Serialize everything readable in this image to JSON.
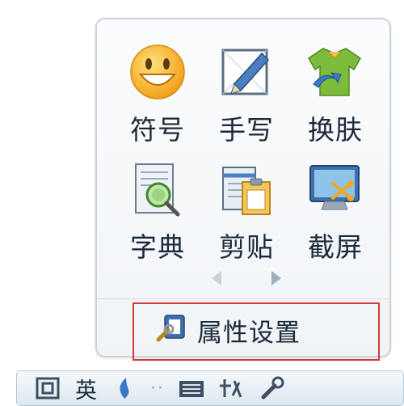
{
  "tools": [
    {
      "label": "符号",
      "icon": "smiley-face-icon"
    },
    {
      "label": "手写",
      "icon": "handwriting-pen-icon"
    },
    {
      "label": "换肤",
      "icon": "skin-shirt-icon"
    },
    {
      "label": "字典",
      "icon": "dictionary-magnifier-icon"
    },
    {
      "label": "剪贴",
      "icon": "clipboard-icon"
    },
    {
      "label": "截屏",
      "icon": "screenshot-icon"
    }
  ],
  "pager": {
    "prev_icon": "triangle-left-icon",
    "next_icon": "triangle-right-icon"
  },
  "settings": {
    "label": "属性设置",
    "icon": "settings-wrench-icon"
  },
  "statusbar": {
    "mode_label": "英"
  },
  "colors": {
    "highlight_border": "#d23a3a",
    "panel_border": "#c9d3dc",
    "text": "#1b2a3a"
  }
}
